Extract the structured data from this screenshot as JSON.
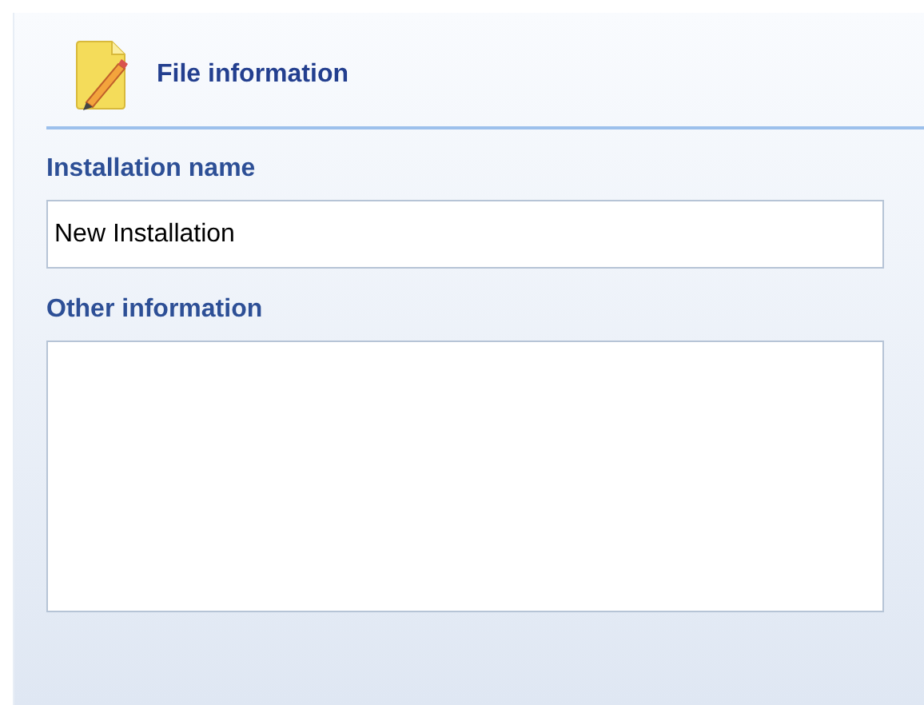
{
  "header": {
    "title": "File information"
  },
  "fields": [
    {
      "kind": "input",
      "label": "Installation name",
      "value": "New Installation"
    },
    {
      "kind": "textarea",
      "label": "Other information"
    }
  ]
}
